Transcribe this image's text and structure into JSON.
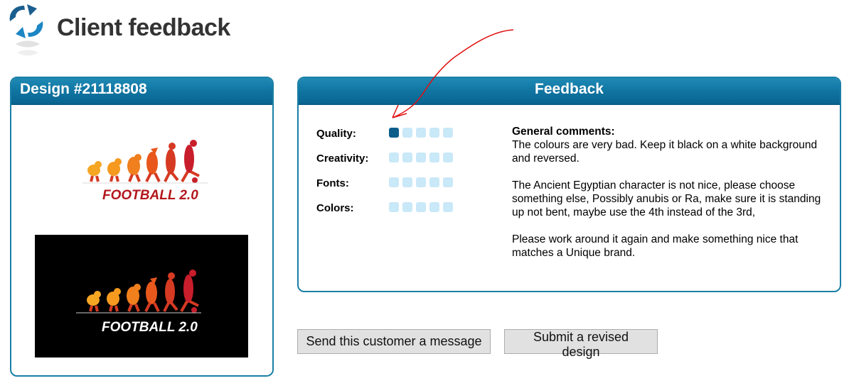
{
  "header": {
    "title": "Client feedback"
  },
  "design_panel": {
    "title": "Design #21118808",
    "logo_text": "FOOTBALL 2.0"
  },
  "feedback_panel": {
    "title": "Feedback",
    "ratings": [
      {
        "label": "Quality:",
        "score": 1,
        "max": 5
      },
      {
        "label": "Creativity:",
        "score": 0,
        "max": 5
      },
      {
        "label": "Fonts:",
        "score": 0,
        "max": 5
      },
      {
        "label": "Colors:",
        "score": 0,
        "max": 5
      }
    ],
    "comments_title": "General comments:",
    "comments": [
      "The colours are very bad. Keep it black on a white background and reversed.",
      "The Ancient Egyptian character is not nice, please choose something else, Possibly anubis or Ra, make sure it is standing up not bent, maybe use the 4th instead of the 3rd,",
      "Please work around it again and make something nice that matches a Unique brand."
    ]
  },
  "actions": {
    "message_label": "Send this customer a message",
    "revise_label": "Submit a revised design"
  },
  "colors": {
    "accent": "#0f73a0",
    "rating_filled": "#0c5e8a",
    "rating_empty": "#c9e8f8",
    "annotation": "#e01010"
  }
}
